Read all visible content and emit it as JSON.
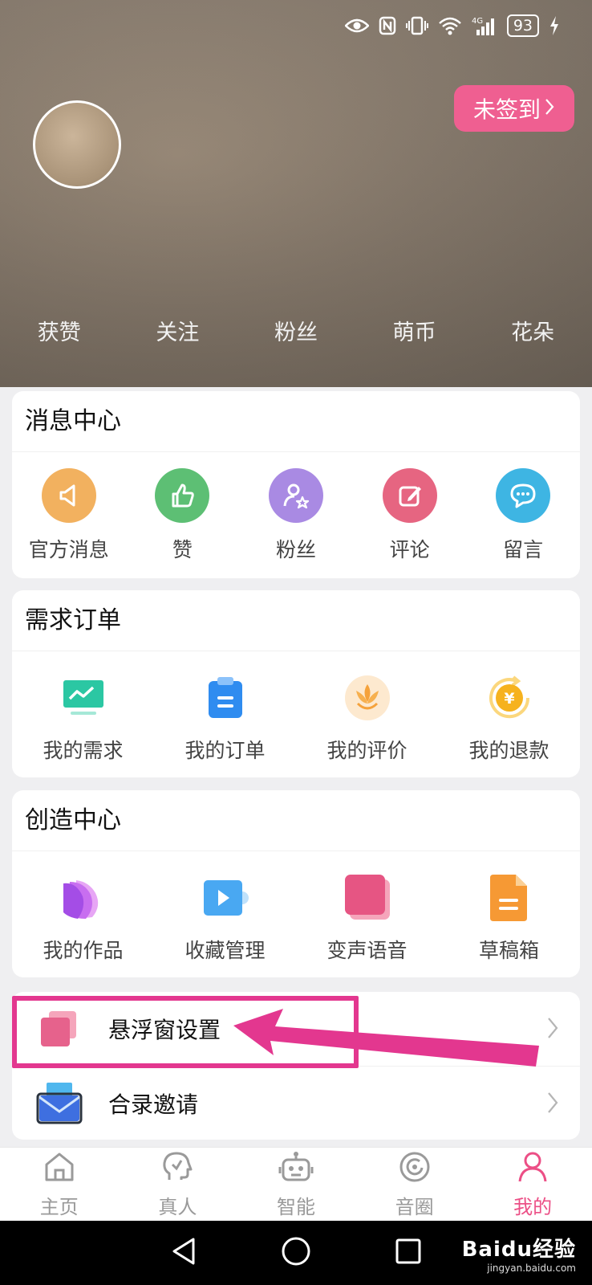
{
  "status_bar": {
    "battery": "93"
  },
  "header": {
    "sign_in_label": "未签到",
    "stats": [
      "获赞",
      "关注",
      "粉丝",
      "萌币",
      "花朵"
    ]
  },
  "message_center": {
    "title": "消息中心",
    "items": [
      {
        "label": "官方消息",
        "icon": "megaphone-icon",
        "color": "#f2b15f"
      },
      {
        "label": "赞",
        "icon": "thumbs-up-icon",
        "color": "#5dbf74"
      },
      {
        "label": "粉丝",
        "icon": "fan-user-icon",
        "color": "#a98ae3"
      },
      {
        "label": "评论",
        "icon": "edit-comment-icon",
        "color": "#e66581"
      },
      {
        "label": "留言",
        "icon": "chat-bubble-icon",
        "color": "#3eb5e3"
      }
    ]
  },
  "orders": {
    "title": "需求订单",
    "items": [
      {
        "label": "我的需求",
        "icon": "monitor-chart-icon"
      },
      {
        "label": "我的订单",
        "icon": "clipboard-icon"
      },
      {
        "label": "我的评价",
        "icon": "flower-icon"
      },
      {
        "label": "我的退款",
        "icon": "refund-yen-icon"
      }
    ]
  },
  "creation_center": {
    "title": "创造中心",
    "items": [
      {
        "label": "我的作品",
        "icon": "works-cards-icon"
      },
      {
        "label": "收藏管理",
        "icon": "video-collection-icon"
      },
      {
        "label": "变声语音",
        "icon": "voice-change-icon"
      },
      {
        "label": "草稿箱",
        "icon": "draft-doc-icon"
      }
    ]
  },
  "settings_list": [
    {
      "label": "悬浮窗设置",
      "icon": "floating-window-icon"
    },
    {
      "label": "合录邀请",
      "icon": "invite-envelope-icon"
    }
  ],
  "tabbar": [
    {
      "label": "主页",
      "icon": "home-icon"
    },
    {
      "label": "真人",
      "icon": "real-person-icon"
    },
    {
      "label": "智能",
      "icon": "robot-icon"
    },
    {
      "label": "音圈",
      "icon": "sound-circle-icon"
    },
    {
      "label": "我的",
      "icon": "profile-icon",
      "active": true
    }
  ],
  "watermark": {
    "main": "Baidu经验",
    "sub": "jingyan.baidu.com"
  },
  "colors": {
    "accent": "#ec4f86",
    "annotation": "#e3378f",
    "sign_in_bg": "#ef5f91"
  }
}
